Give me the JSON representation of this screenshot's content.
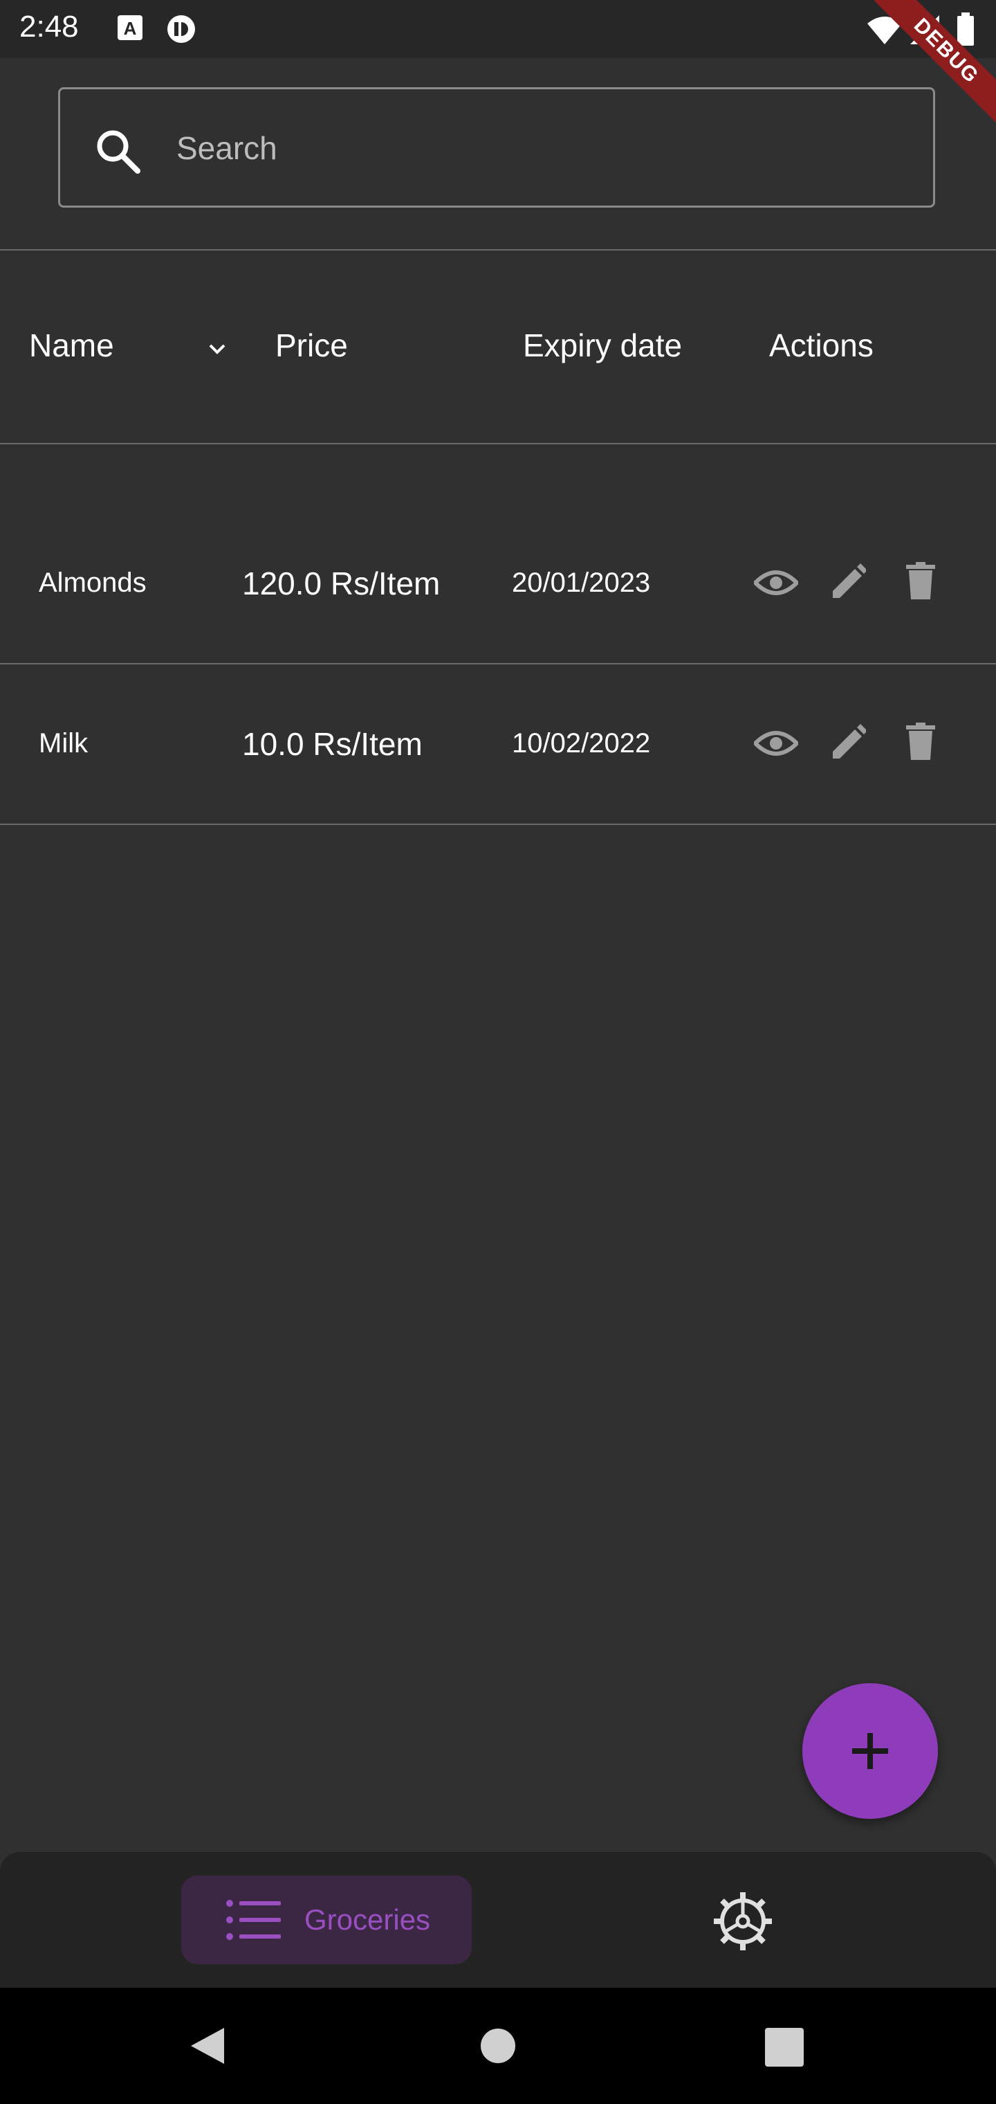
{
  "status_bar": {
    "time": "2:48"
  },
  "debug_banner": {
    "label": "DEBUG"
  },
  "search": {
    "placeholder": "Search",
    "value": ""
  },
  "table": {
    "columns": [
      "Name",
      "Price",
      "Expiry date",
      "Actions"
    ],
    "rows": [
      {
        "name": "Almonds",
        "price": "120.0 Rs/Item",
        "expiry": "20/01/2023"
      },
      {
        "name": "Milk",
        "price": "10.0 Rs/Item",
        "expiry": "10/02/2022"
      }
    ],
    "actions": [
      "eye-icon",
      "pencil-icon",
      "trash-icon"
    ]
  },
  "fab": {
    "icon": "plus-icon"
  },
  "bottom_nav": {
    "items": [
      {
        "label": "Groceries",
        "icon": "list-icon",
        "active": true
      },
      {
        "label": "",
        "icon": "gear-icon",
        "active": false
      }
    ]
  },
  "colors": {
    "background": "#303030",
    "accent": "#8e3cb9",
    "nav_active_bg": "#3b2744",
    "icon_grey": "#9e9e9e"
  }
}
